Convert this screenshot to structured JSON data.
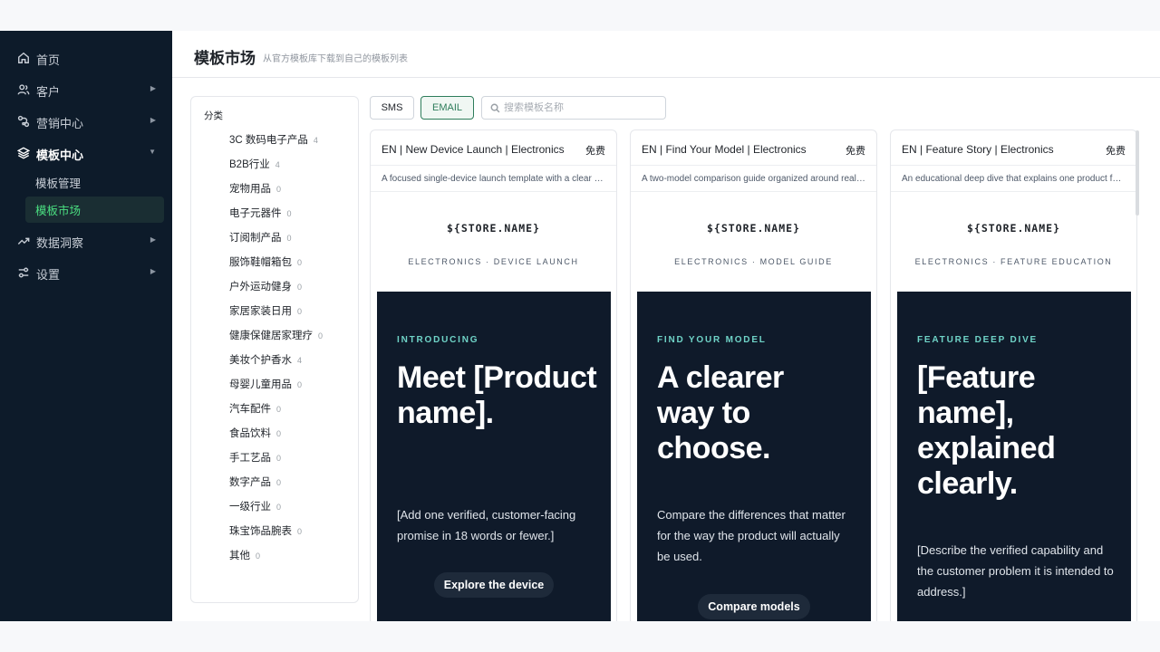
{
  "sidebar": {
    "items": [
      {
        "label": "首页",
        "icon": "home-icon"
      },
      {
        "label": "客户",
        "icon": "users-icon"
      },
      {
        "label": "营销中心",
        "icon": "flow-icon"
      },
      {
        "label": "模板中心",
        "icon": "layers-icon"
      },
      {
        "label": "数据洞察",
        "icon": "trend-icon"
      },
      {
        "label": "设置",
        "icon": "sliders-icon"
      }
    ],
    "sub_items": [
      {
        "label": "模板管理"
      },
      {
        "label": "模板市场"
      }
    ]
  },
  "header": {
    "title": "模板市场",
    "subtitle": "从官方模板库下载到自己的模板列表"
  },
  "categories": {
    "title": "分类",
    "items": [
      {
        "label": "3C 数码电子产品",
        "count": "4"
      },
      {
        "label": "B2B行业",
        "count": "4"
      },
      {
        "label": "宠物用品",
        "count": "0"
      },
      {
        "label": "电子元器件",
        "count": "0"
      },
      {
        "label": "订阅制产品",
        "count": "0"
      },
      {
        "label": "服饰鞋帽箱包",
        "count": "0"
      },
      {
        "label": "户外运动健身",
        "count": "0"
      },
      {
        "label": "家居家装日用",
        "count": "0"
      },
      {
        "label": "健康保健居家理疗",
        "count": "0"
      },
      {
        "label": "美妆个护香水",
        "count": "4"
      },
      {
        "label": "母婴儿童用品",
        "count": "0"
      },
      {
        "label": "汽车配件",
        "count": "0"
      },
      {
        "label": "食品饮料",
        "count": "0"
      },
      {
        "label": "手工艺品",
        "count": "0"
      },
      {
        "label": "数字产品",
        "count": "0"
      },
      {
        "label": "一级行业",
        "count": "0"
      },
      {
        "label": "珠宝饰品腕表",
        "count": "0"
      },
      {
        "label": "其他",
        "count": "0"
      }
    ]
  },
  "tabs": {
    "sms": "SMS",
    "email": "EMAIL"
  },
  "search": {
    "placeholder": "搜索模板名称"
  },
  "cards": [
    {
      "name": "EN | New Device Launch | Electronics",
      "price": "免费",
      "desc": "A focused single-device launch template with a clear hero, verified proof points and a single CTA.",
      "store": "${STORE.NAME}",
      "category": "ELECTRONICS · DEVICE LAUNCH",
      "eyebrow": "INTRODUCING",
      "headline": "Meet [Product name].",
      "body": "[Add one verified, customer-facing promise in 18 words or fewer.]",
      "cta": "Explore the device"
    },
    {
      "name": "EN | Find Your Model | Electronics",
      "price": "免费",
      "desc": "A two-model comparison guide organized around real usage scenarios.",
      "store": "${STORE.NAME}",
      "category": "ELECTRONICS · MODEL GUIDE",
      "eyebrow": "FIND YOUR MODEL",
      "headline": "A clearer way to choose.",
      "body": "Compare the differences that matter for the way the product will actually be used.",
      "cta": "Compare models"
    },
    {
      "name": "EN | Feature Story | Electronics",
      "price": "免费",
      "desc": "An educational deep dive that explains one product feature in plain language.",
      "store": "${STORE.NAME}",
      "category": "ELECTRONICS · FEATURE EDUCATION",
      "eyebrow": "FEATURE DEEP DIVE",
      "headline": "[Feature name], explained clearly.",
      "body": "[Describe the verified capability and the customer problem it is intended to address.]",
      "cta": ""
    }
  ],
  "colors": {
    "sidebar_bg": "#0d1b2a",
    "accent": "#4ade80",
    "hero_bg": "#0f1a2a",
    "eyebrow": "#6fd3c7",
    "tab_active": "#2e7d5b"
  }
}
